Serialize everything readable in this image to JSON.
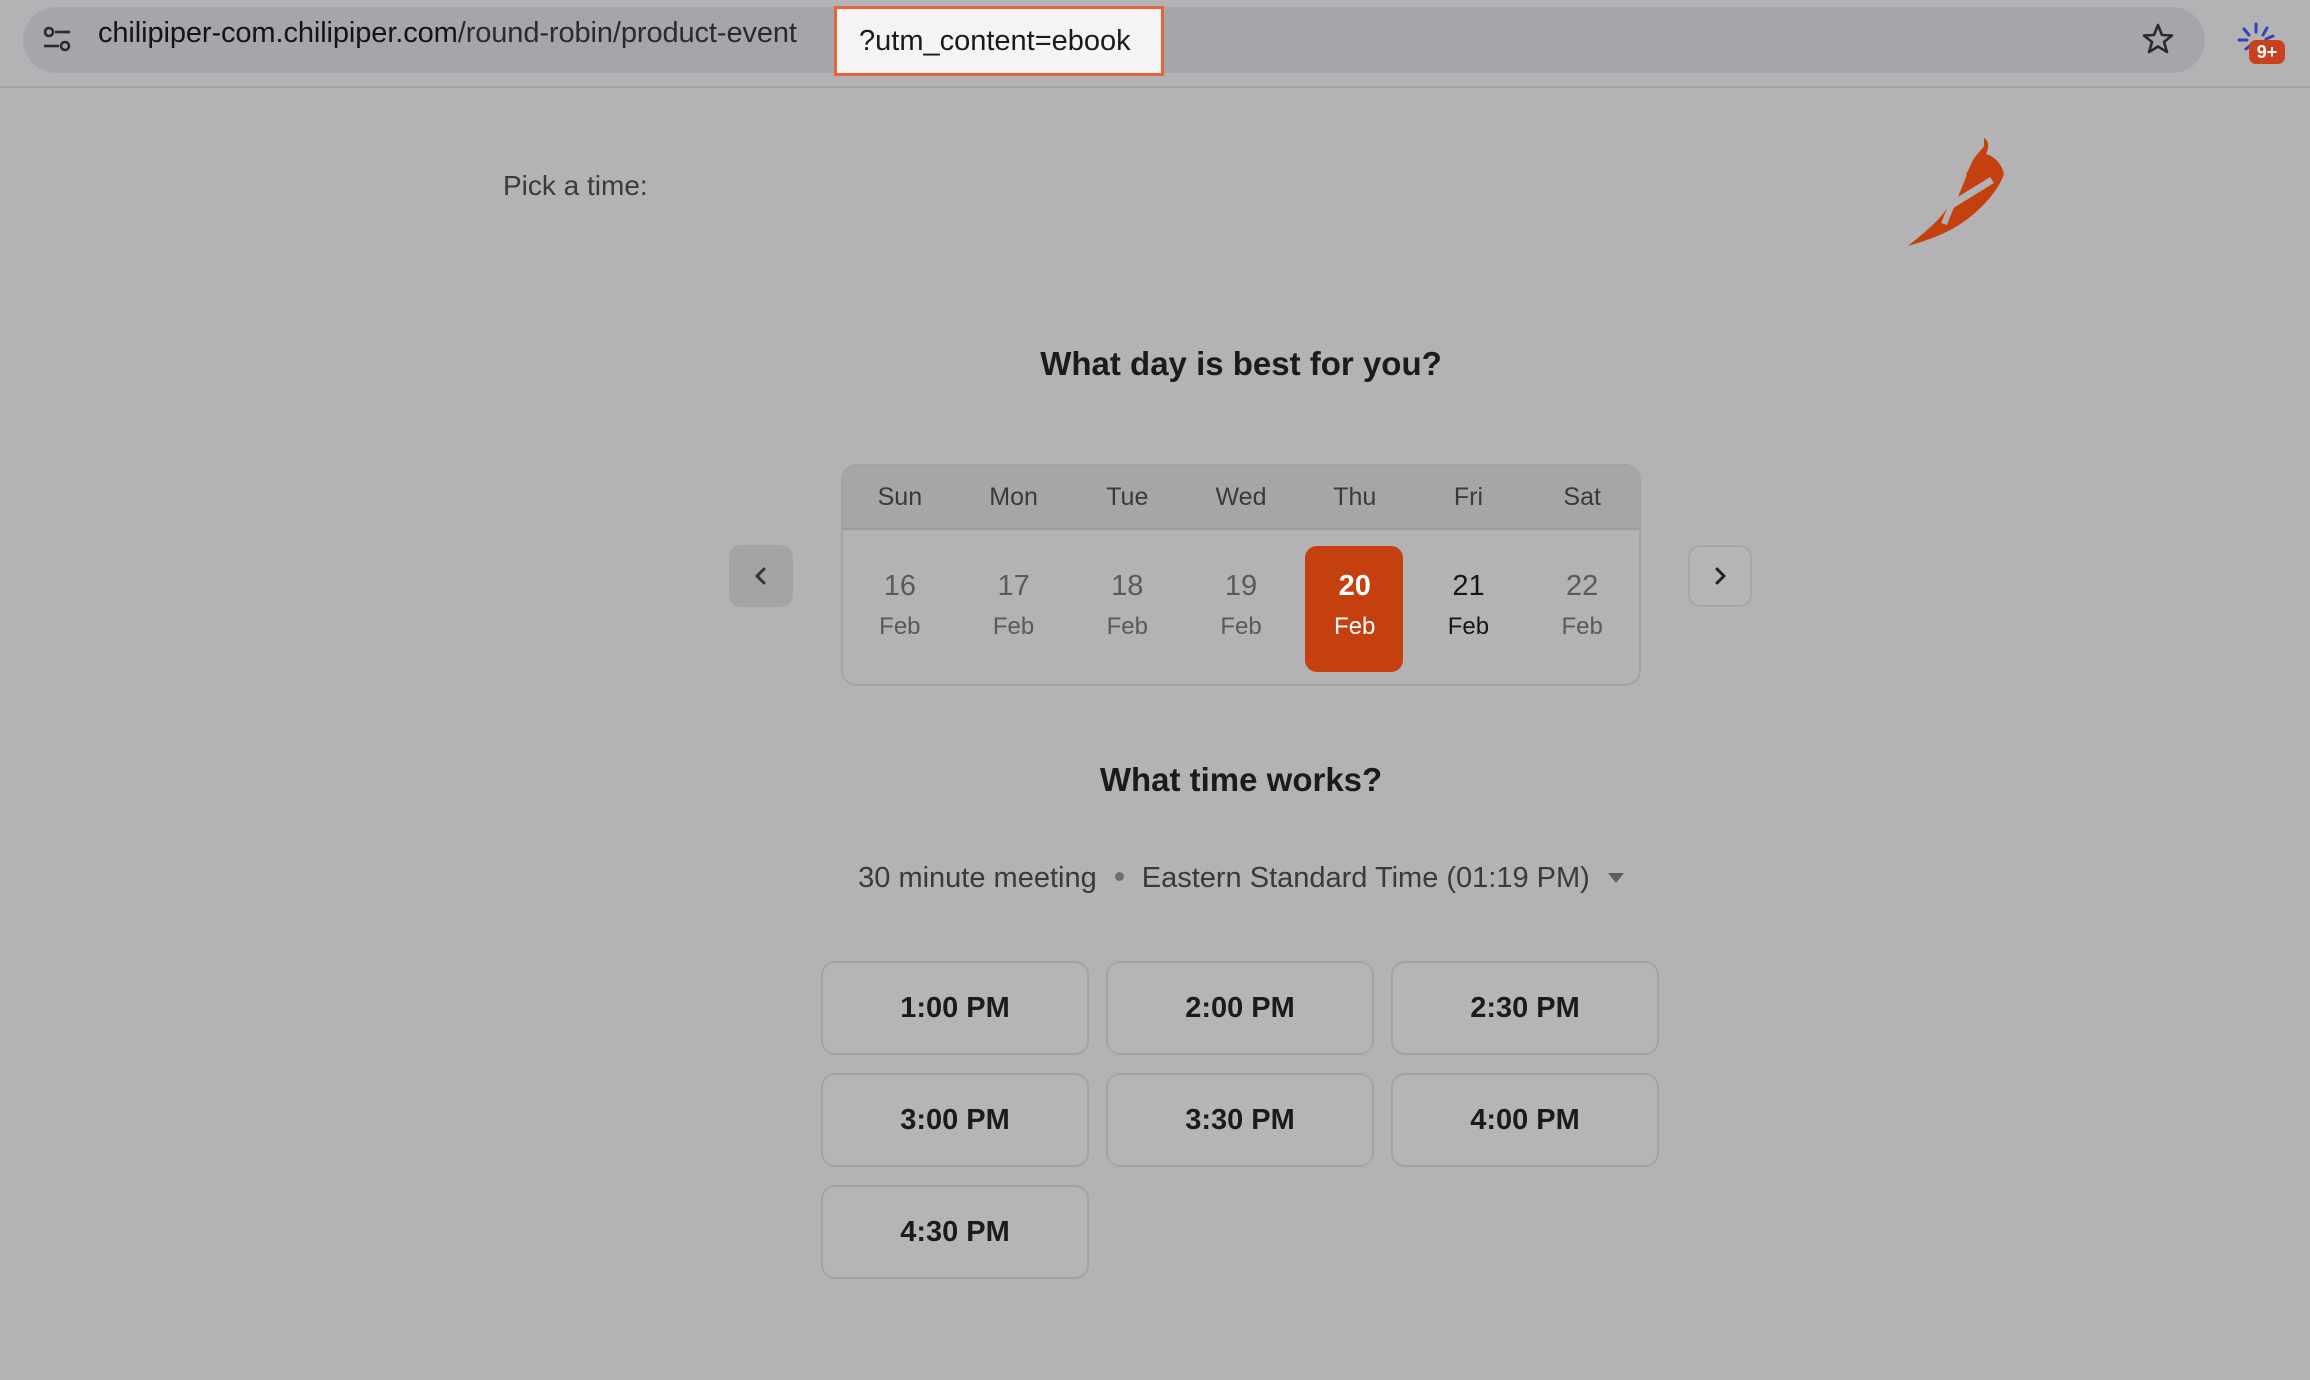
{
  "browser": {
    "url_host": "chilipiper-com.chilipiper.com",
    "url_path": "/round-robin/product-event",
    "url_query": "?utm_content=ebook",
    "extension_badge": "9+"
  },
  "page": {
    "pick_label": "Pick a time:",
    "day_heading": "What day is best for you?",
    "time_heading": "What time works?",
    "meeting_length": "30 minute meeting",
    "timezone": "Eastern Standard Time (01:19 PM)"
  },
  "calendar": {
    "weekdays": [
      "Sun",
      "Mon",
      "Tue",
      "Wed",
      "Thu",
      "Fri",
      "Sat"
    ],
    "days": [
      {
        "num": "16",
        "month": "Feb"
      },
      {
        "num": "17",
        "month": "Feb"
      },
      {
        "num": "18",
        "month": "Feb"
      },
      {
        "num": "19",
        "month": "Feb"
      },
      {
        "num": "20",
        "month": "Feb"
      },
      {
        "num": "21",
        "month": "Feb"
      },
      {
        "num": "22",
        "month": "Feb"
      }
    ],
    "selected_index": 4
  },
  "slots": [
    "1:00 PM",
    "2:00 PM",
    "2:30 PM",
    "3:00 PM",
    "3:30 PM",
    "4:00 PM",
    "4:30 PM"
  ],
  "colors": {
    "accent": "#c5400f",
    "highlight_border": "#e8623c"
  }
}
